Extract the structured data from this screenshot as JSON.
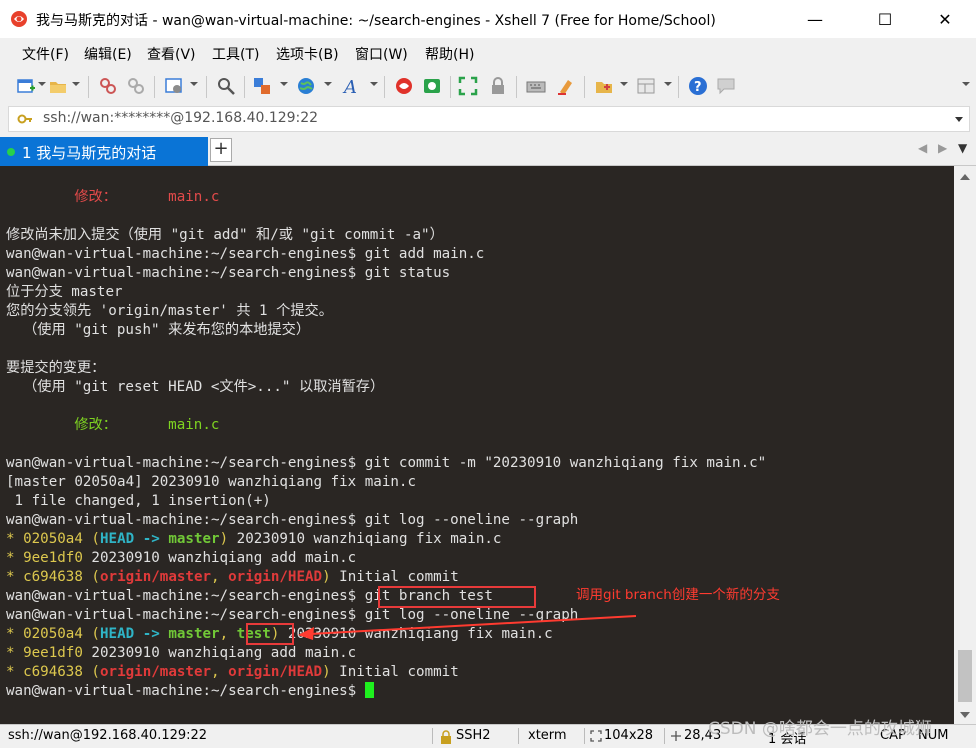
{
  "window": {
    "title": "我与马斯克的对话 - wan@wan-virtual-machine: ~/search-engines - Xshell 7 (Free for Home/School)",
    "minimize": "—",
    "maximize": "☐",
    "close": "✕"
  },
  "menu": [
    "文件(F)",
    "编辑(E)",
    "查看(V)",
    "工具(T)",
    "选项卡(B)",
    "窗口(W)",
    "帮助(H)"
  ],
  "toolbar": {
    "icons": [
      "new-session-icon",
      "open-folder-icon",
      "disconnect-icon",
      "reconnect-icon",
      "properties-icon",
      "find-icon",
      "transfer-icon",
      "globe-icon",
      "font-icon",
      "xshell-icon",
      "xftp-icon",
      "fullscreen-icon",
      "lock-icon",
      "keyboard-icon",
      "highlight-icon",
      "script-icon",
      "layout-icon",
      "help-icon",
      "chat-icon"
    ]
  },
  "address": {
    "value": "ssh://wan:********@192.168.40.129:22"
  },
  "tabs": [
    {
      "label": "1 我与马斯克的对话",
      "active": true
    }
  ],
  "tab_add_label": "+",
  "terminal": {
    "lines": [
      [
        {
          "t": "        "
        },
        {
          "t": "修改：      main.c",
          "c": "c-red"
        }
      ],
      [
        {
          "t": ""
        }
      ],
      [
        {
          "t": "修改尚未加入提交（使用 \"git add\" 和/或 \"git commit -a\"）"
        }
      ],
      [
        {
          "t": "wan@wan-virtual-machine:~/search-engines$ git add main.c"
        }
      ],
      [
        {
          "t": "wan@wan-virtual-machine:~/search-engines$ git status"
        }
      ],
      [
        {
          "t": "位于分支 master"
        }
      ],
      [
        {
          "t": "您的分支领先 'origin/master' 共 1 个提交。"
        }
      ],
      [
        {
          "t": "  （使用 \"git push\" 来发布您的本地提交）"
        }
      ],
      [
        {
          "t": ""
        }
      ],
      [
        {
          "t": "要提交的变更："
        }
      ],
      [
        {
          "t": "  （使用 \"git reset HEAD <文件>...\" 以取消暂存）"
        }
      ],
      [
        {
          "t": ""
        }
      ],
      [
        {
          "t": "        "
        },
        {
          "t": "修改：      main.c",
          "c": "c-green"
        }
      ],
      [
        {
          "t": ""
        }
      ],
      [
        {
          "t": "wan@wan-virtual-machine:~/search-engines$ git commit -m \"20230910 wanzhiqiang fix main.c\""
        }
      ],
      [
        {
          "t": "[master 02050a4] 20230910 wanzhiqiang fix main.c"
        }
      ],
      [
        {
          "t": " 1 file changed, 1 insertion(+)"
        }
      ],
      [
        {
          "t": "wan@wan-virtual-machine:~/search-engines$ git log --oneline --graph"
        }
      ],
      [
        {
          "t": "* ",
          "c": "c-yel"
        },
        {
          "t": "02050a4",
          "c": "c-yel"
        },
        {
          "t": " (",
          "c": "c-yel"
        },
        {
          "t": "HEAD -> ",
          "c": "c-head"
        },
        {
          "t": "master",
          "c": "c-master"
        },
        {
          "t": ")",
          "c": "c-yel"
        },
        {
          "t": " 20230910 wanzhiqiang fix main.c"
        }
      ],
      [
        {
          "t": "* ",
          "c": "c-yel"
        },
        {
          "t": "9ee1df0",
          "c": "c-yel"
        },
        {
          "t": " 20230910 wanzhiqiang add main.c"
        }
      ],
      [
        {
          "t": "* ",
          "c": "c-yel"
        },
        {
          "t": "c694638",
          "c": "c-yel"
        },
        {
          "t": " (",
          "c": "c-yel"
        },
        {
          "t": "origin/master",
          "c": "c-origin"
        },
        {
          "t": ", ",
          "c": "c-yel"
        },
        {
          "t": "origin/HEAD",
          "c": "c-origin"
        },
        {
          "t": ")",
          "c": "c-yel"
        },
        {
          "t": " Initial commit"
        }
      ],
      [
        {
          "t": "wan@wan-virtual-machine:~/search-engines$ git branch test"
        }
      ],
      [
        {
          "t": "wan@wan-virtual-machine:~/search-engines$ git log --oneline --graph"
        }
      ],
      [
        {
          "t": "* ",
          "c": "c-yel"
        },
        {
          "t": "02050a4",
          "c": "c-yel"
        },
        {
          "t": " (",
          "c": "c-yel"
        },
        {
          "t": "HEAD -> ",
          "c": "c-head"
        },
        {
          "t": "master",
          "c": "c-master"
        },
        {
          "t": ", ",
          "c": "c-yel"
        },
        {
          "t": "test",
          "c": "c-test"
        },
        {
          "t": ")",
          "c": "c-yel"
        },
        {
          "t": " 20230910 wanzhiqiang fix main.c"
        }
      ],
      [
        {
          "t": "* ",
          "c": "c-yel"
        },
        {
          "t": "9ee1df0",
          "c": "c-yel"
        },
        {
          "t": " 20230910 wanzhiqiang add main.c"
        }
      ],
      [
        {
          "t": "* ",
          "c": "c-yel"
        },
        {
          "t": "c694638",
          "c": "c-yel"
        },
        {
          "t": " (",
          "c": "c-yel"
        },
        {
          "t": "origin/master",
          "c": "c-origin"
        },
        {
          "t": ", ",
          "c": "c-yel"
        },
        {
          "t": "origin/HEAD",
          "c": "c-origin"
        },
        {
          "t": ")",
          "c": "c-yel"
        },
        {
          "t": " Initial commit"
        }
      ],
      [
        {
          "t": "wan@wan-virtual-machine:~/search-engines$ "
        },
        {
          "t": "",
          "cursor": true
        }
      ]
    ]
  },
  "annotation": {
    "text": "调用git branch创建一个新的分支"
  },
  "status": {
    "connection": "ssh://wan@192.168.40.129:22",
    "protocol": "SSH2",
    "terminal_type": "xterm",
    "size": "104x28",
    "cursor_pos": "28,43",
    "sessions": "1 会话",
    "caps": "CAP",
    "num": "NUM"
  },
  "watermark": "CSDN @啥都会一点的攻城狮",
  "colors": {
    "tab_active": "#0a74d6",
    "terminal_bg": "#2a2623",
    "annotation": "#ff3b30",
    "cursor": "#1ef01e"
  }
}
